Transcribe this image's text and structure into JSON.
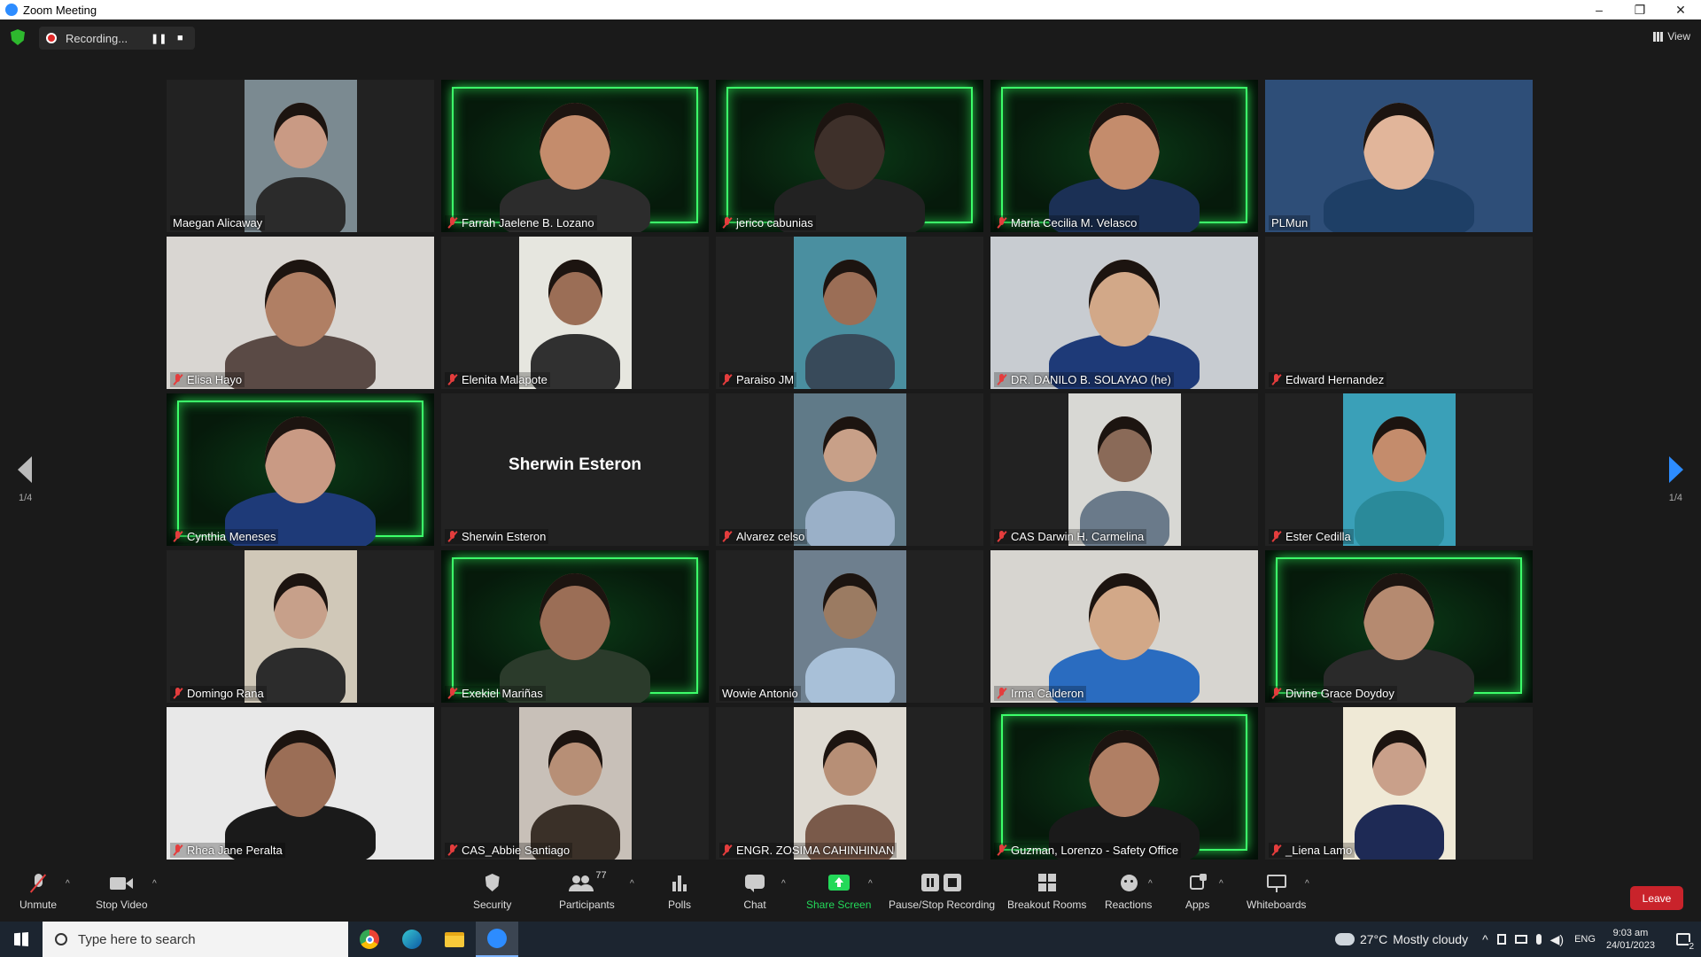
{
  "window": {
    "title": "Zoom Meeting",
    "min": "–",
    "restore": "❐",
    "close": "✕"
  },
  "topbar": {
    "recording_label": "Recording...",
    "pause": "❚❚",
    "stop": "■",
    "view_label": "View"
  },
  "participants": [
    {
      "name": "Maegan Alicaway",
      "muted": false
    },
    {
      "name": "Farrah Jaelene B. Lozano",
      "muted": true
    },
    {
      "name": "jerico cabunias",
      "muted": true
    },
    {
      "name": "Maria Cecilia M. Velasco",
      "muted": true
    },
    {
      "name": "PLMun",
      "muted": false
    },
    {
      "name": "Elisa Hayo",
      "muted": true
    },
    {
      "name": "Elenita Malapote",
      "muted": true
    },
    {
      "name": "Paraiso JM",
      "muted": true
    },
    {
      "name": "DR. DANILO B. SOLAYAO (he)",
      "muted": true
    },
    {
      "name": "Edward Hernandez",
      "muted": true
    },
    {
      "name": "Cynthia Meneses",
      "muted": true
    },
    {
      "name": "Sherwin Esteron",
      "muted": true
    },
    {
      "name": "Alvarez celso",
      "muted": true
    },
    {
      "name": "CAS Darwin H. Carmelina",
      "muted": true
    },
    {
      "name": "Ester Cedilla",
      "muted": true
    },
    {
      "name": "Domingo Rana",
      "muted": true
    },
    {
      "name": "Exekiel Mariñas",
      "muted": true
    },
    {
      "name": "Wowie Antonio",
      "muted": false
    },
    {
      "name": "Irma Calderon",
      "muted": true
    },
    {
      "name": "Divine Grace Doydoy",
      "muted": true
    },
    {
      "name": "Rhea Jane Peralta",
      "muted": true
    },
    {
      "name": "CAS_Abbie Santiago",
      "muted": true
    },
    {
      "name": "ENGR. ZOSIMA CAHINHINAN",
      "muted": true
    },
    {
      "name": "Guzman, Lorenzo - Safety Office",
      "muted": true
    },
    {
      "name": "_Liena Lamo",
      "muted": true
    }
  ],
  "pager": {
    "left": "1/4",
    "right": "1/4"
  },
  "toolbar": {
    "unmute": "Unmute",
    "stop_video": "Stop Video",
    "security": "Security",
    "participants": "Participants",
    "participants_count": "77",
    "polls": "Polls",
    "chat": "Chat",
    "share_screen": "Share Screen",
    "recording": "Pause/Stop Recording",
    "breakout": "Breakout Rooms",
    "reactions": "Reactions",
    "apps": "Apps",
    "whiteboards": "Whiteboards",
    "leave": "Leave"
  },
  "taskbar": {
    "search_placeholder": "Type here to search",
    "weather_temp": "27°C",
    "weather_text": "Mostly cloudy",
    "lang": "ENG",
    "time": "9:03 am",
    "date": "24/01/2023",
    "notif_count": "2"
  },
  "colors": {
    "active_speaker": "#f2e34b",
    "muted_red": "#e43d3d",
    "leave_red": "#c9232b",
    "share_green": "#23d959",
    "banner_green": "#3cff6a"
  }
}
